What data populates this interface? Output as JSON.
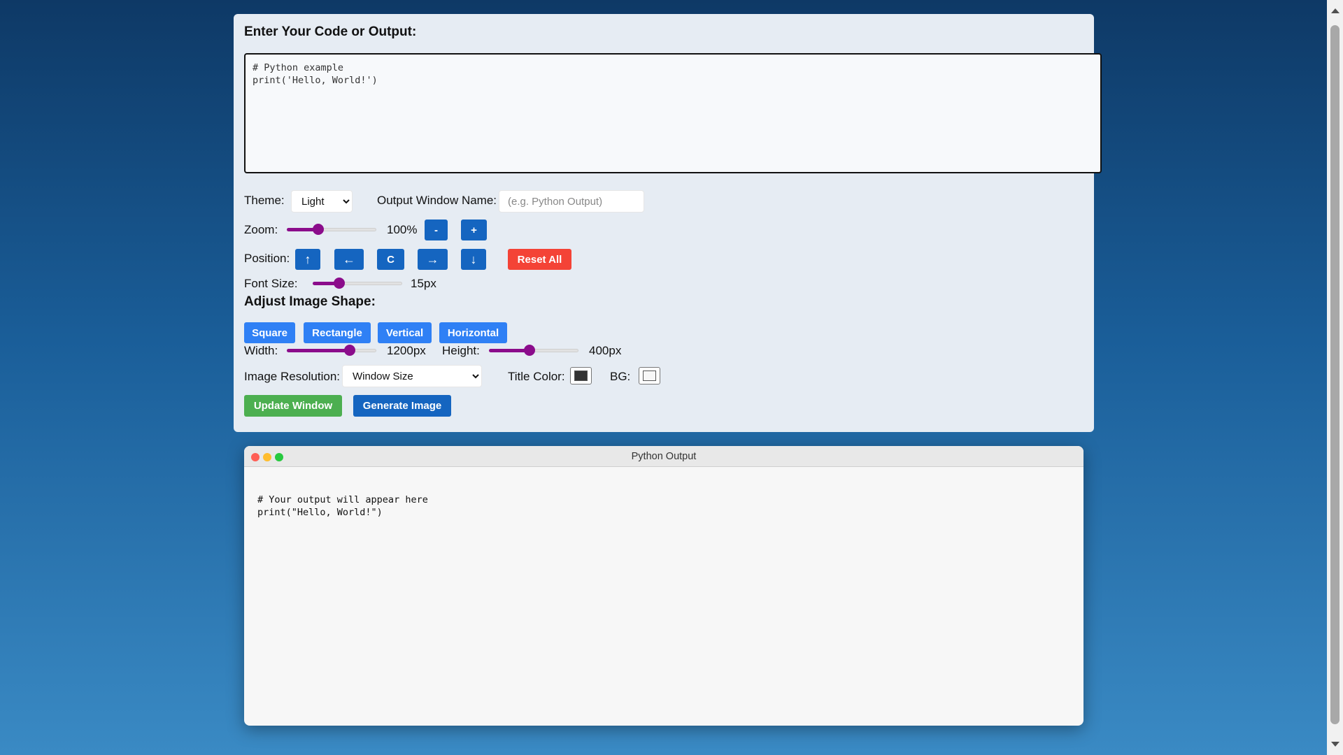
{
  "editor": {
    "heading": "Enter Your Code or Output:",
    "code": "# Python example\nprint('Hello, World!')"
  },
  "theme": {
    "label": "Theme:",
    "value": "Light"
  },
  "window_name": {
    "label": "Output Window Name:",
    "placeholder": "(e.g. Python Output)"
  },
  "zoom": {
    "label": "Zoom:",
    "value_text": "100%",
    "level": 0.35,
    "minus": "-",
    "plus": "+"
  },
  "position": {
    "label": "Position:",
    "up": "↑",
    "left": "←",
    "center": "C",
    "right": "→",
    "down": "↓",
    "reset": "Reset All"
  },
  "font_size": {
    "label": "Font Size:",
    "value_text": "15px",
    "level": 0.3
  },
  "shape": {
    "heading": "Adjust Image Shape:",
    "square": "Square",
    "rectangle": "Rectangle",
    "vertical": "Vertical",
    "horizontal": "Horizontal"
  },
  "width": {
    "label": "Width:",
    "value_text": "1200px",
    "level": 0.7
  },
  "height": {
    "label": "Height:",
    "value_text": "400px",
    "level": 0.45
  },
  "resolution": {
    "label": "Image Resolution:",
    "value": "Window Size"
  },
  "title_color": {
    "label": "Title Color:",
    "color": "#333333"
  },
  "bg": {
    "label": "BG:",
    "color": "#f7f7f7"
  },
  "actions": {
    "update": "Update Window",
    "generate": "Generate Image"
  },
  "output_window": {
    "title": "Python Output",
    "content": "# Your output will appear here\nprint(\"Hello, World!\")",
    "dot_colors": [
      "#ff5f56",
      "#ffbd2e",
      "#27c93f"
    ]
  }
}
